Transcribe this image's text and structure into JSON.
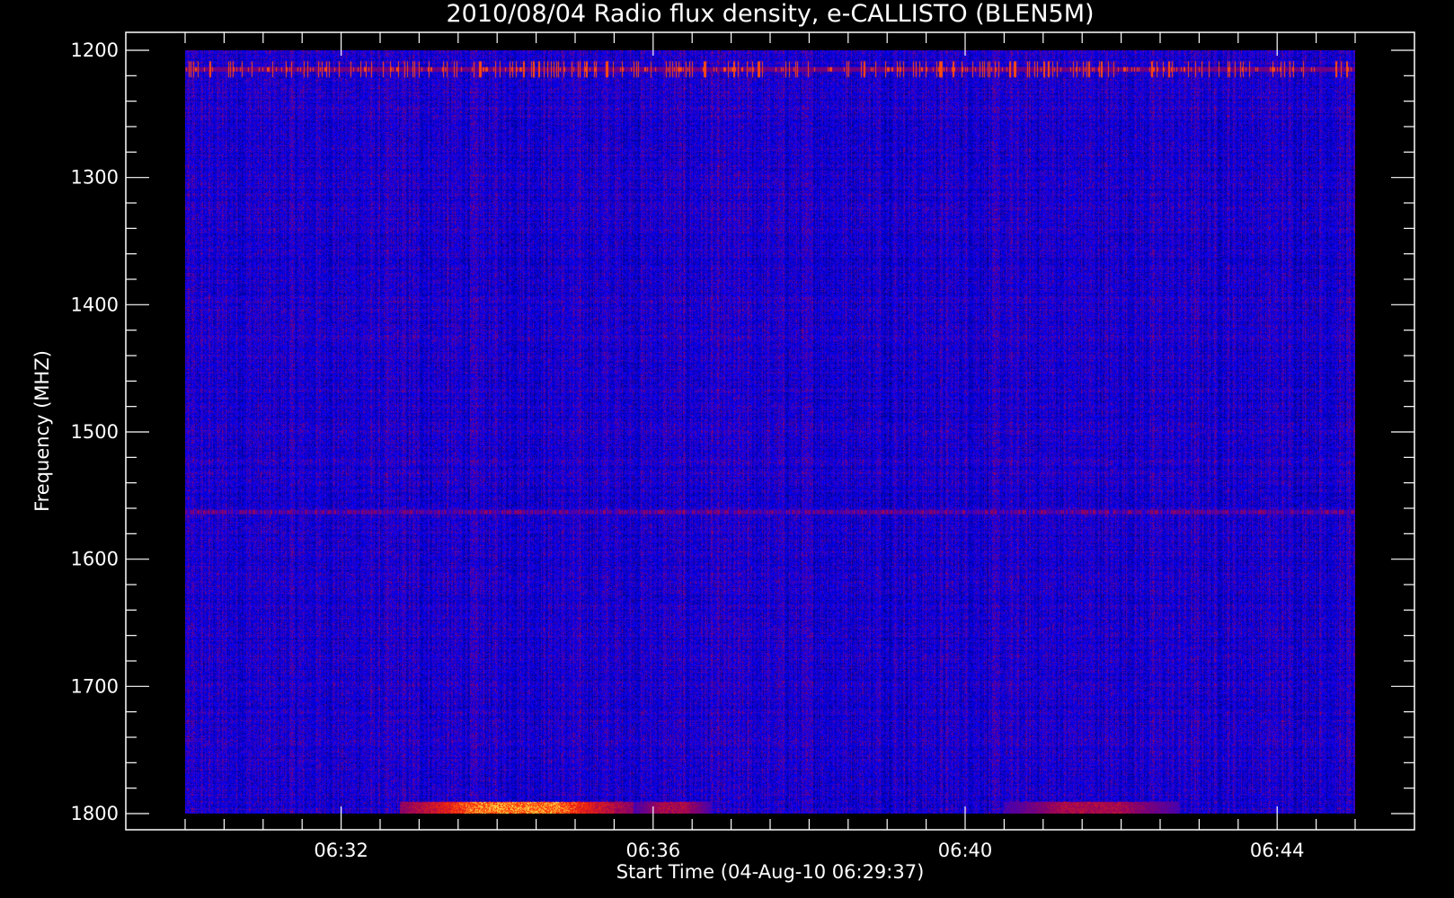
{
  "chart_data": {
    "type": "heatmap",
    "title": "2010/08/04  Radio flux density, e-CALLISTO (BLEN5M)",
    "xlabel": "Start Time (04-Aug-10 06:29:37)",
    "ylabel": "Frequency (MHZ)",
    "x_axis": {
      "unit": "time",
      "start": "06:29:37",
      "data_range": [
        "06:30:00",
        "06:45:00"
      ],
      "ticks": [
        "06:32",
        "06:36",
        "06:40",
        "06:44"
      ],
      "minor_tick_interval_s": 30
    },
    "y_axis": {
      "unit": "MHz",
      "range": [
        1200,
        1800
      ],
      "inverted": true,
      "ticks": [
        1200,
        1300,
        1400,
        1500,
        1600,
        1700,
        1800
      ],
      "minor_tick_interval": 20
    },
    "colormap": [
      "#000000",
      "#0000ff",
      "#8b0000",
      "#ff0000",
      "#ffff00"
    ],
    "background": "blue noise (radio background)",
    "features": [
      {
        "name": "interference-band",
        "freq_mhz": 1215,
        "intensity": 0.9,
        "kind": "spiky"
      },
      {
        "name": "interference-band",
        "freq_mhz": 1563,
        "intensity": 0.75,
        "kind": "continuous"
      },
      {
        "name": "bright-burst",
        "time_range": [
          "06:32:45",
          "06:35:45"
        ],
        "freq_range_mhz": [
          1795,
          1800
        ],
        "intensity": 1.0
      },
      {
        "name": "bright-burst",
        "time_range": [
          "06:35:45",
          "06:36:45"
        ],
        "freq_range_mhz": [
          1795,
          1800
        ],
        "intensity": 0.8
      },
      {
        "name": "bright-burst",
        "time_range": [
          "06:40:30",
          "06:42:45"
        ],
        "freq_range_mhz": [
          1795,
          1800
        ],
        "intensity": 0.8
      }
    ]
  }
}
